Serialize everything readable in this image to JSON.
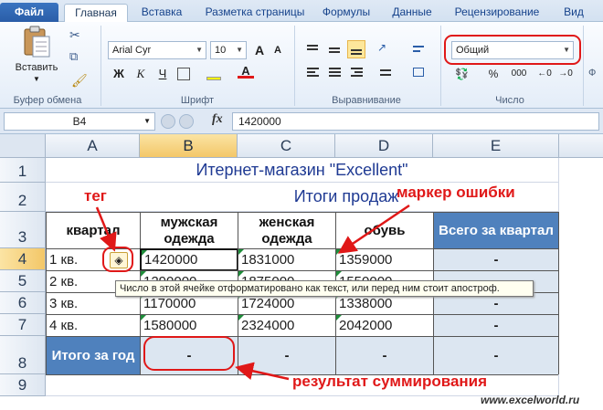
{
  "ribbon_tabs": [
    "Файл",
    "Главная",
    "Вставка",
    "Разметка страницы",
    "Формулы",
    "Данные",
    "Рецензирование",
    "Вид"
  ],
  "ribbon": {
    "paste_label": "Вставить",
    "clipboard_group": "Буфер обмена",
    "font_group": "Шрифт",
    "align_group": "Выравнивание",
    "number_group": "Число",
    "font_name": "Arial Cyr",
    "font_size": "10",
    "number_format": "Общий",
    "bold": "Ж",
    "italic": "К",
    "underline": "Ч",
    "grow_font": "A",
    "shrink_font": "A",
    "percent": "%",
    "thousands": "000"
  },
  "formula_bar": {
    "name_box": "B4",
    "fx": "fx",
    "value": "1420000"
  },
  "columns": [
    "A",
    "B",
    "C",
    "D",
    "E"
  ],
  "rows": [
    "1",
    "2",
    "3",
    "4",
    "5",
    "6",
    "7",
    "8",
    "9"
  ],
  "sheet": {
    "title": "Итернет-магазин \"Excellent\"",
    "subtitle": "Итоги продаж",
    "headers": [
      "квартал",
      "мужская одежда",
      "женская одежда",
      "обувь",
      "Всего за квартал"
    ],
    "data": [
      [
        "1 кв.",
        "1420000",
        "1831000",
        "1359000",
        "-"
      ],
      [
        "2 кв.",
        "1290000",
        "1875000",
        "1550000",
        "-"
      ],
      [
        "3 кв.",
        "1170000",
        "1724000",
        "1338000",
        "-"
      ],
      [
        "4 кв.",
        "1580000",
        "2324000",
        "2042000",
        "-"
      ]
    ],
    "total_label": "Итого за год",
    "totals": [
      "-",
      "-",
      "-",
      "-"
    ]
  },
  "tooltip": "Число в этой ячейке отформатировано как текст, или перед ним стоит апостроф.",
  "annotations": {
    "tag": "тег",
    "error_marker": "маркер ошибки",
    "sum_result": "результат суммирования",
    "watermark": "www.excelworld.ru"
  },
  "colors": {
    "accent_red": "#e01818",
    "header_blue": "#4f81bd",
    "light_blue": "#dce6f1"
  }
}
